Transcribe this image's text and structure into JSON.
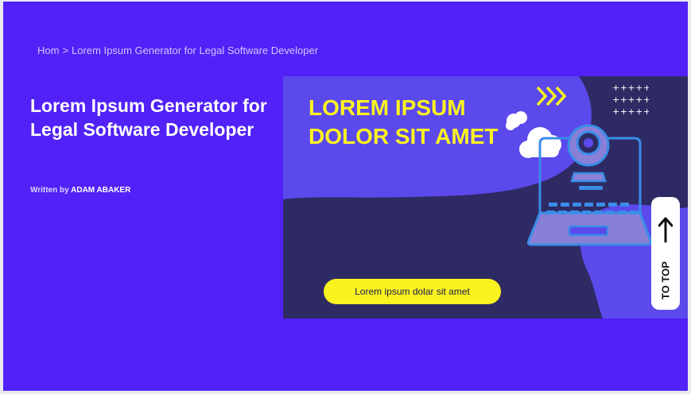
{
  "breadcrumb": {
    "home": "Hom",
    "separator": ">",
    "current": "Lorem Ipsum Generator for Legal Software Developer"
  },
  "article": {
    "title": "Lorem Ipsum Generator for Legal Software Developer",
    "byline_prefix": "Written by",
    "author": "ADAM ABAKER"
  },
  "hero": {
    "headline": "LOREM IPSUM DOLOR SIT AMET",
    "cta_label": "Lorem ipsum dolar sit amet",
    "plus_rows": [
      "+++++",
      "+++++",
      "+++++"
    ]
  },
  "to_top": {
    "label": "TO TOP",
    "icon": "arrow-up-icon"
  },
  "colors": {
    "page_bg": "#5121f7",
    "hero_dark": "#2e2b64",
    "hero_light": "#5b49ec",
    "accent_yellow": "#fbf31f"
  }
}
